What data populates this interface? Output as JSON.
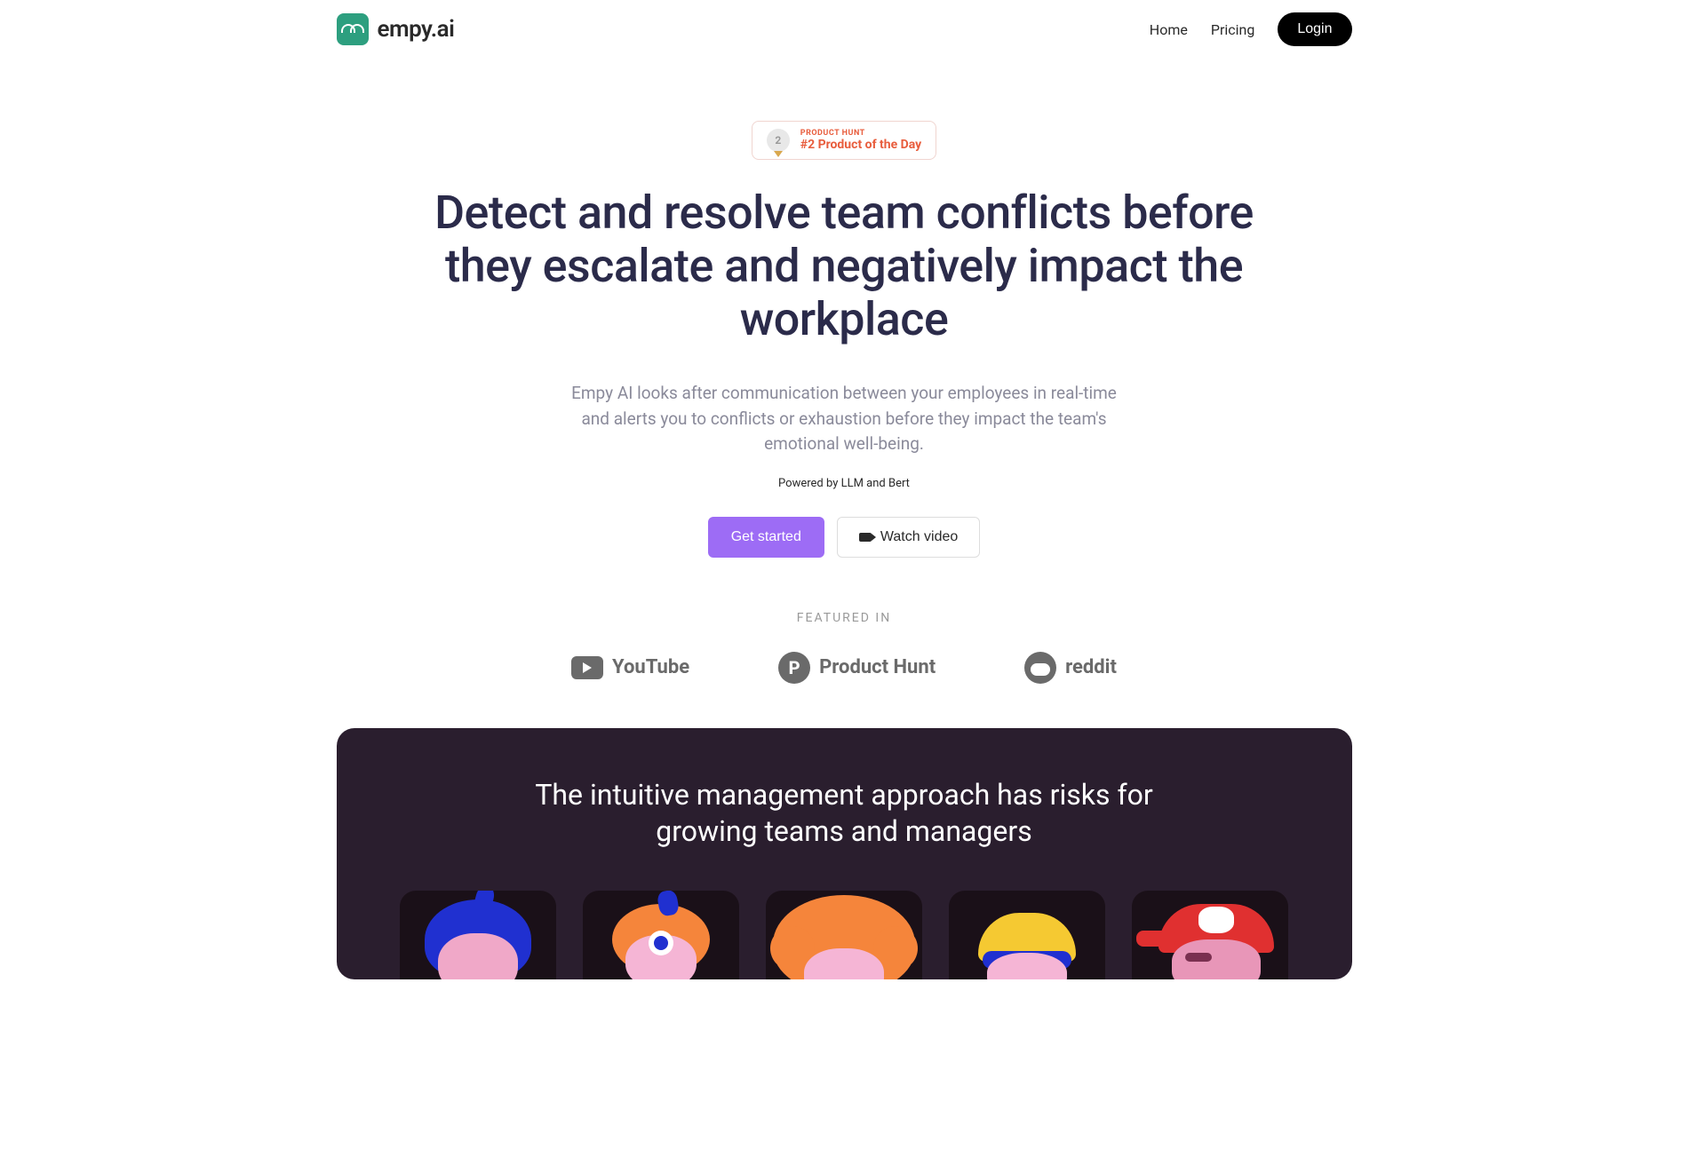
{
  "brand": {
    "name": "empy.ai"
  },
  "nav": {
    "home": "Home",
    "pricing": "Pricing",
    "login": "Login"
  },
  "ph_badge": {
    "label": "PRODUCT HUNT",
    "rank_text": "#2 Product of the Day",
    "medal_number": "2"
  },
  "hero": {
    "title": "Detect and resolve team conflicts before they escalate and negatively impact the workplace",
    "subtitle": "Empy AI looks after communication between your employees in real-time and alerts you to conflicts or exhaustion before they impact the team's emotional well-being.",
    "powered": "Powered by LLM and Bert",
    "cta_primary": "Get started",
    "cta_secondary": "Watch video"
  },
  "featured": {
    "label": "FEATURED IN",
    "items": [
      "YouTube",
      "Product Hunt",
      "reddit"
    ]
  },
  "dark_section": {
    "title": "The intuitive management approach has risks for growing teams and managers"
  }
}
